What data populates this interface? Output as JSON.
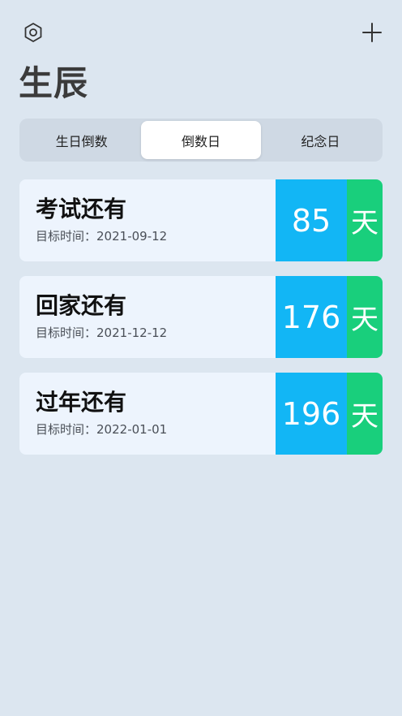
{
  "header": {
    "settings_icon": "settings-icon",
    "add_icon": "plus-icon",
    "title": "生辰"
  },
  "tabs": [
    {
      "label": "生日倒数",
      "active": false
    },
    {
      "label": "倒数日",
      "active": true
    },
    {
      "label": "纪念日",
      "active": false
    }
  ],
  "items": [
    {
      "title": "考试还有",
      "date_label": "目标时间：",
      "date": "2021-09-12",
      "days": "85",
      "unit": "天"
    },
    {
      "title": "回家还有",
      "date_label": "目标时间：",
      "date": "2021-12-12",
      "days": "176",
      "unit": "天"
    },
    {
      "title": "过年还有",
      "date_label": "目标时间：",
      "date": "2022-01-01",
      "days": "196",
      "unit": "天"
    }
  ],
  "colors": {
    "background": "#dce6f0",
    "card": "#edf4fd",
    "days_bg": "#12b6f5",
    "unit_bg": "#19cf7c"
  }
}
